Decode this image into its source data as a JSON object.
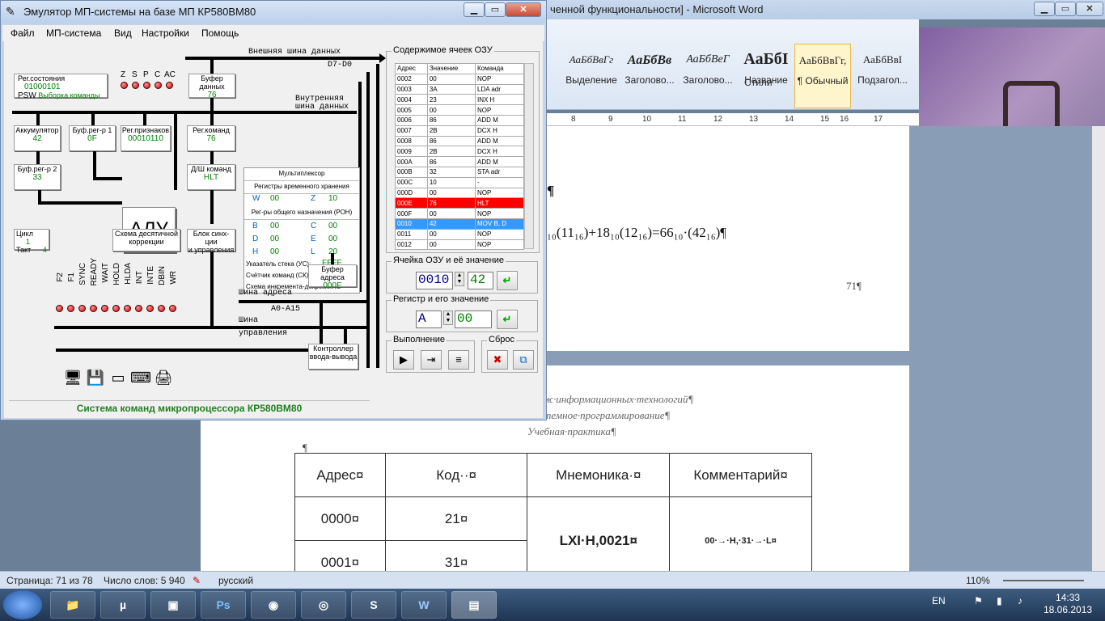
{
  "word": {
    "title": "ченной функциональности] - Microsoft Word",
    "styles": [
      {
        "sample": "АаБбВвГг",
        "label": "Выделение"
      },
      {
        "sample": "АаБбВв",
        "label": "Заголово..."
      },
      {
        "sample": "АаБбВеГ",
        "label": "Заголово..."
      },
      {
        "sample": "АаБбІ",
        "label": "Название"
      },
      {
        "sample": "АаБбВвГг,",
        "label": "¶ Обычный"
      },
      {
        "sample": "АаБбВвІ",
        "label": "Подзагол..."
      }
    ],
    "styles_caption": "Стили",
    "ruler": [
      "8",
      "9",
      "10",
      "11",
      "12",
      "13",
      "14",
      "15",
      "16",
      "17"
    ],
    "page1": {
      "mark1": "¶",
      "formula": "₁₀(11₁₆)+18₁₀(12₁₆)=66₁₀·(42₁₆)¶",
      "page_num": "71¶"
    },
    "page2": {
      "line1": "ж·информационных·технологий¶",
      "line2": "темное·программирование¶",
      "line3": "Учебная·практика¶",
      "para": "¶",
      "table_head": [
        "Адрес¤",
        "Код··¤",
        "Мнемоника·¤",
        "Комментарий¤"
      ],
      "row1": {
        "addr": "0000¤",
        "code": "21¤"
      },
      "row2": {
        "addr": "0001¤",
        "code": "31¤",
        "mnem": "LXI·H,0021¤",
        "comment": "00·→·H,·31·→·L¤"
      },
      "row_end": "¤"
    },
    "status": {
      "page": "Страница: 71 из 78",
      "words": "Число слов: 5 940",
      "lang": "русский",
      "zoom": "110%"
    }
  },
  "taskbar": {
    "lang": "EN",
    "time": "14:33",
    "date": "18.06.2013",
    "apps": [
      "explorer",
      "utorrent",
      "video",
      "Ps",
      "firefox",
      "chrome",
      "skype",
      "W",
      "kp580"
    ]
  },
  "emulator": {
    "title": "Эмулятор МП-системы на базе МП КР580ВМ80",
    "menu": [
      "Файл",
      "МП-система",
      "Вид",
      "Настройки",
      "Помощь"
    ],
    "buses": {
      "ext_data": "Внешняя шина данных",
      "d7d0": "D7-D0",
      "int_data_1": "Внутренняя",
      "int_data_2": "шина данных",
      "addr": "Шина адреса",
      "a0a15": "A0-A15",
      "ctrl_1": "Шина",
      "ctrl_2": "управления"
    },
    "psw": {
      "label1": "Рег.состояния",
      "label2": "PSW",
      "value": "01000101",
      "desc": "Выборка команды"
    },
    "flags": [
      "Z",
      "S",
      "P",
      "C",
      "AC"
    ],
    "data_buf": {
      "label": "Буфер данных",
      "value": "76"
    },
    "acc": {
      "label": "Аккумулятор",
      "value": "42"
    },
    "buf1": {
      "label": "Буф.рег-р 1",
      "value": "0F"
    },
    "flagreg": {
      "label": "Рег.признаков",
      "value": "00010110"
    },
    "cmdreg": {
      "label": "Рег.команд",
      "value": "76"
    },
    "buf2": {
      "label": "Буф.рег-р 2",
      "value": "33"
    },
    "decoder": {
      "label": "Д/Ш команд",
      "value": "HLT"
    },
    "alu": "АЛУ",
    "mux": "Мультиплексор",
    "temp_regs": "Регистры временного хранения",
    "w": {
      "name": "W",
      "value": "00"
    },
    "z": {
      "name": "Z",
      "value": "10"
    },
    "gpr_label": "Рег-ры общего назначения (РОН)",
    "gpr": [
      {
        "n1": "B",
        "v1": "00",
        "n2": "C",
        "v2": "00"
      },
      {
        "n1": "D",
        "v1": "00",
        "n2": "E",
        "v2": "00"
      },
      {
        "n1": "H",
        "v1": "00",
        "n2": "L",
        "v2": "20"
      }
    ],
    "sp": {
      "label": "Указатель стека (УС):",
      "value": "FFFF"
    },
    "pc": {
      "label": "Счётчик команд (СК):",
      "value": "0010"
    },
    "incdec": {
      "label": "Схема инкремента-декремента",
      "value": "+1"
    },
    "cycle": {
      "label": "Цикл",
      "value": "1"
    },
    "tact": {
      "label": "Такт",
      "value": "4"
    },
    "decimal": {
      "l1": "Схема десятичной",
      "l2": "коррекции"
    },
    "sync": {
      "l1": "Блок синх-ции",
      "l2": "и управления"
    },
    "addr_buf": {
      "l1": "Буфер адреса",
      "value": "000E"
    },
    "io": {
      "l1": "Контроллер",
      "l2": "ввода-вывода"
    },
    "signals": [
      "F2",
      "F1",
      "SYNC",
      "READY",
      "WAIT",
      "HOLD",
      "HLDA",
      "INT",
      "INTE",
      "DBIN",
      "WR"
    ],
    "memory": {
      "caption": "Содержимое ячеек ОЗУ",
      "headers": [
        "Адрес",
        "Значение",
        "Команда"
      ],
      "rows": [
        [
          "0002",
          "00",
          "NOP"
        ],
        [
          "0003",
          "3A",
          "LDA adr"
        ],
        [
          "0004",
          "23",
          "INX H"
        ],
        [
          "0005",
          "00",
          "NOP"
        ],
        [
          "0006",
          "86",
          "ADD M"
        ],
        [
          "0007",
          "2B",
          "DCX H"
        ],
        [
          "0008",
          "86",
          "ADD M"
        ],
        [
          "0009",
          "2B",
          "DCX H"
        ],
        [
          "000A",
          "86",
          "ADD M"
        ],
        [
          "000B",
          "32",
          "STA adr"
        ],
        [
          "000C",
          "10",
          "-"
        ],
        [
          "000D",
          "00",
          "NOP"
        ],
        [
          "000E",
          "76",
          "HLT"
        ],
        [
          "000F",
          "00",
          "NOP"
        ],
        [
          "0010",
          "42",
          "MOV B, D"
        ],
        [
          "0011",
          "00",
          "NOP"
        ],
        [
          "0012",
          "00",
          "NOP"
        ]
      ],
      "highlight_red": "000E",
      "highlight_sel": "0010"
    },
    "cell": {
      "caption": "Ячейка ОЗУ и её значение",
      "addr": "0010",
      "value": "42"
    },
    "reg": {
      "caption": "Регистр и его значение",
      "name": "A",
      "value": "00"
    },
    "exec_caption": "Выполнение",
    "reset_caption": "Сброс",
    "footer": "Система команд микропроцессора КР580ВМ80"
  }
}
